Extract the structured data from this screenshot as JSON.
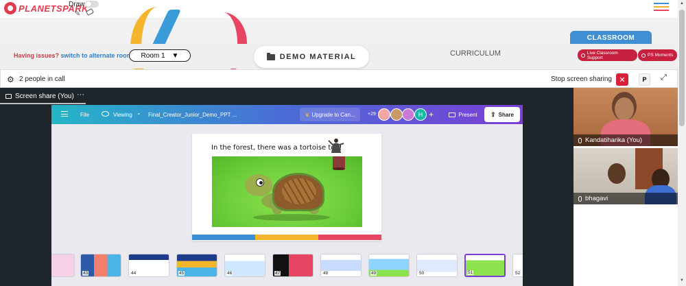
{
  "app": {
    "logo_text": "PLANETSPARK",
    "draw_label": "Draw"
  },
  "header": {
    "issues_text": "Having issues?",
    "switch_link": "switch to alternate room",
    "room_label": "Room 1",
    "room_chevron": "▼",
    "demo_material": "DEMO MATERIAL",
    "curriculum": "CURRICULUM",
    "classroom_tab": "CLASSROOM",
    "live_support": "Live Classroom Support",
    "ps_moments": "PS Moments"
  },
  "callbar": {
    "people_count": "2 people in call",
    "stop_sharing": "Stop screen sharing",
    "close_symbol": "✕",
    "p_label": "P",
    "expand_symbol": "⤢"
  },
  "share": {
    "label": "Screen share (You)",
    "menu": "···"
  },
  "canva": {
    "file": "File",
    "viewing": "Viewing",
    "viewing_chevron": "⌄",
    "doc_title": "Final_Creator_Junior_Demo_PPT ...",
    "upgrade": "Upgrade to Can...",
    "collab_count": "+29",
    "h_avatar": "H",
    "plus": "+",
    "present": "Present",
    "share": "Share"
  },
  "slide": {
    "text": "In the forest, there was a tortoise too!"
  },
  "thumbnails": [
    {
      "num": "43",
      "color": "#2d5ba8"
    },
    {
      "num": "44",
      "color": "#ffffff"
    },
    {
      "num": "45",
      "color": "#1e3a8a"
    },
    {
      "num": "46",
      "color": "#e8f4ff"
    },
    {
      "num": "47",
      "color": "#111111"
    },
    {
      "num": "48",
      "color": "#dfe9ff"
    },
    {
      "num": "49",
      "color": "#8fd4ff"
    },
    {
      "num": "50",
      "color": "#ffffff"
    },
    {
      "num": "51",
      "color": "#8ce34d"
    },
    {
      "num": "52",
      "color": "#ffffff"
    }
  ],
  "participants": [
    {
      "name": "Kandatiharika (You)"
    },
    {
      "name": "bhagavi"
    }
  ],
  "colors": {
    "brand_red": "#e33b4e",
    "classroom_blue": "#3f8fd2",
    "canva_purple": "#7b3fd6",
    "stop_red": "#d8203a",
    "bar_blue": "#3a8fd6",
    "bar_yellow": "#f4b52c",
    "bar_pink": "#e84564"
  }
}
